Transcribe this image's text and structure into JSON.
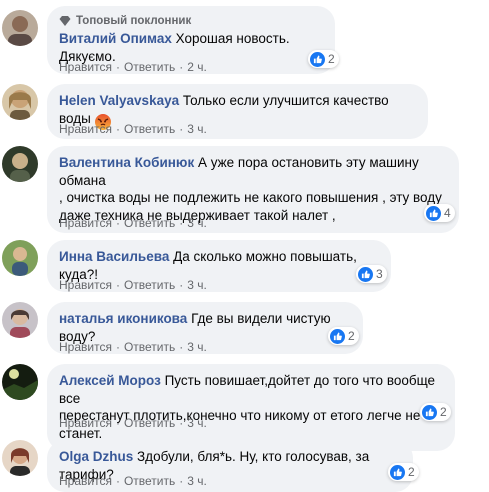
{
  "comments": [
    {
      "badge": "Топовый поклонник",
      "author": "Виталий Опимах",
      "text": "Хорошая новость. Дякуємо.",
      "like": "Нравится",
      "reply": "Ответить",
      "time": "2 ч.",
      "reaction_count": "2"
    },
    {
      "author": "Helen Valyavskaya",
      "text": "Только если улучшится качество воды",
      "like": "Нравится",
      "reply": "Ответить",
      "time": "3 ч."
    },
    {
      "author": "Валентина Кобинюк",
      "text_lines": [
        "А уже пора остановить эту машину обмана",
        ", очистка воды не подлежить не какого повышения , эту воду",
        "даже техника не выдерживает такой налет ,"
      ],
      "like": "Нравится",
      "reply": "Ответить",
      "time": "3 ч.",
      "reaction_count": "4"
    },
    {
      "author": "Инна Васильева",
      "text": "Да сколько можно повышать, куда?!",
      "like": "Нравится",
      "reply": "Ответить",
      "time": "3 ч.",
      "reaction_count": "3"
    },
    {
      "author": "наталья иконикова",
      "text": "Где вы видели чистую воду?",
      "like": "Нравится",
      "reply": "Ответить",
      "time": "3 ч.",
      "reaction_count": "2"
    },
    {
      "author": "Алексей Мороз",
      "text_lines": [
        "Пусть повишает,дойтет до того что вообще все",
        "перестанут плотить,конечно что никому от етого легче не станет."
      ],
      "like": "Нравится",
      "reply": "Ответить",
      "time": "3 ч.",
      "reaction_count": "2"
    },
    {
      "author": "Olga Dzhus",
      "text": "Здобули, бля*ь. Ну, кто голосував, за тарифи?",
      "like": "Нравится",
      "reply": "Ответить",
      "time": "3 ч.",
      "reaction_count": "2"
    }
  ],
  "colors": {
    "author": "#385898",
    "bubble": "#f0f2f5",
    "like_blue": "#1877f2",
    "meta": "#65676b"
  }
}
